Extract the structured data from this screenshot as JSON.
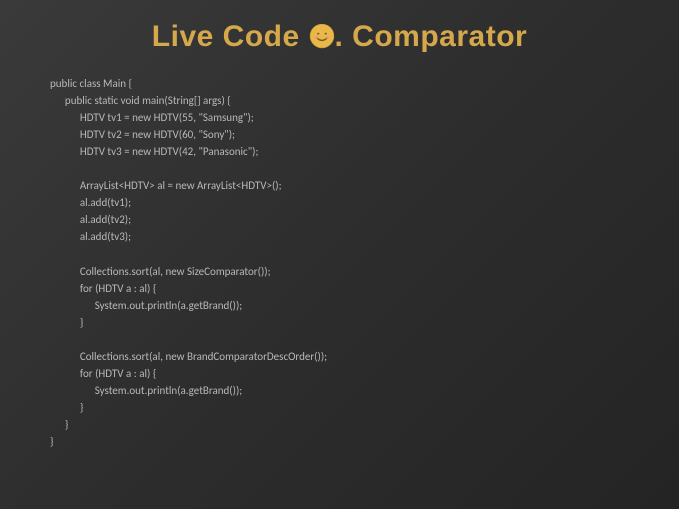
{
  "title_part1": "Live Code ",
  "title_emoji": "☺",
  "title_part2": ". Comparator",
  "code": "public class Main {\n      public static void main(String[] args) {\n            HDTV tv1 = new HDTV(55, \"Samsung\");\n            HDTV tv2 = new HDTV(60, \"Sony\");\n            HDTV tv3 = new HDTV(42, \"Panasonic\");\n\n            ArrayList<HDTV> al = new ArrayList<HDTV>();\n            al.add(tv1);\n            al.add(tv2);\n            al.add(tv3);\n\n            Collections.sort(al, new SizeComparator());\n            for (HDTV a : al) {\n                  System.out.println(a.getBrand());\n            }\n\n            Collections.sort(al, new BrandComparatorDescOrder());\n            for (HDTV a : al) {\n                  System.out.println(a.getBrand());\n            }\n      }\n}"
}
